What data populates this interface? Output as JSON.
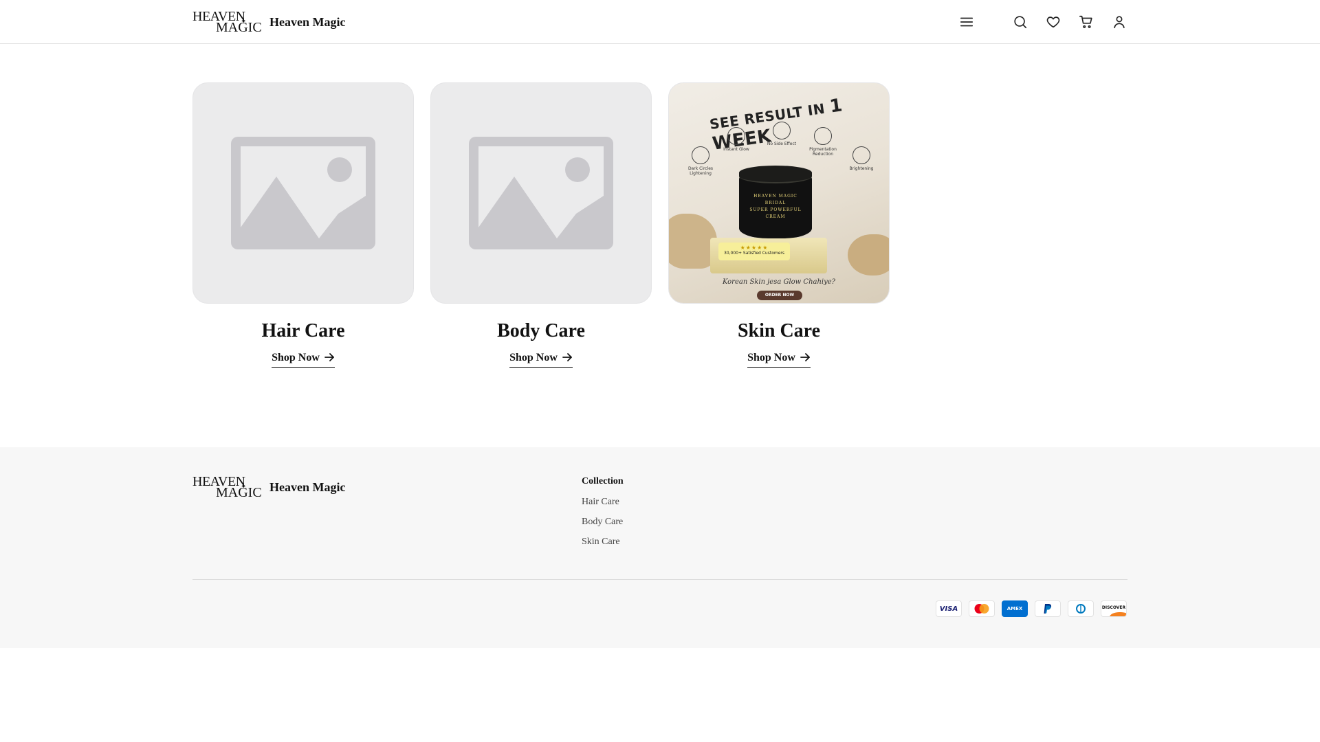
{
  "brand": {
    "logo_line1": "HEAVEN",
    "logo_line2": "MAGIC",
    "name": "Heaven Magic"
  },
  "header": {
    "icons": [
      "menu-icon",
      "search-icon",
      "heart-icon",
      "cart-icon",
      "account-icon"
    ]
  },
  "collections": [
    {
      "title": "Hair Care",
      "link_label": "Shop Now",
      "image": "placeholder-image"
    },
    {
      "title": "Body Care",
      "link_label": "Shop Now",
      "image": "placeholder-image"
    },
    {
      "title": "Skin Care",
      "link_label": "Shop Now",
      "image": "product-promo-image"
    }
  ],
  "promo": {
    "headline_a": "SEE RESULT IN",
    "headline_b": "1 WEEK",
    "benefits": [
      "Dark Circles Lightening",
      "Instant Glow",
      "No Side Effect",
      "Pigmentation Reduction",
      "Brightening"
    ],
    "jar_label": [
      "HEAVEN MAGIC",
      "BRIDAL",
      "SUPER POWERFUL",
      "CREAM"
    ],
    "stars": "★★★★★",
    "badge_text": "30,000+ Satisfied Customers",
    "tagline": "Korean Skin jesa Glow Chahiye?",
    "cta": "ORDER NOW"
  },
  "footer": {
    "column_title": "Collection",
    "links": [
      "Hair Care",
      "Body Care",
      "Skin Care"
    ],
    "payment_methods": [
      "VISA",
      "Mastercard",
      "AMEX",
      "PayPal",
      "Diners Club",
      "DISCOVER"
    ]
  },
  "colors": {
    "page_bg": "#ffffff",
    "footer_bg": "#f7f7f7",
    "placeholder_bg": "#ebebec",
    "placeholder_icon": "#c9c8cc",
    "text": "#111111"
  }
}
